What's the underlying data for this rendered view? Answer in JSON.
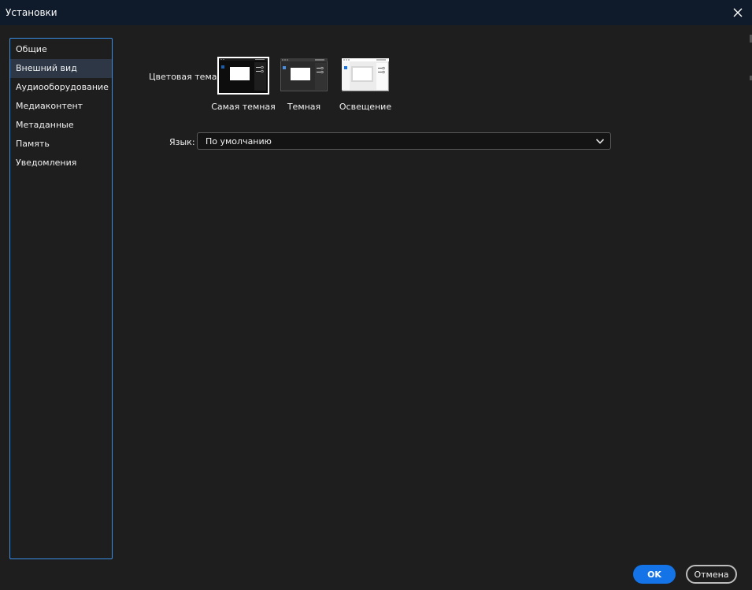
{
  "window": {
    "title": "Установки"
  },
  "sidebar": {
    "items": [
      {
        "label": "Общие",
        "active": false
      },
      {
        "label": "Внешний вид",
        "active": true
      },
      {
        "label": "Аудиооборудование",
        "active": false
      },
      {
        "label": "Медиаконтент",
        "active": false
      },
      {
        "label": "Метаданные",
        "active": false
      },
      {
        "label": "Память",
        "active": false
      },
      {
        "label": "Уведомления",
        "active": false
      }
    ]
  },
  "appearance": {
    "theme_label": "Цветовая тема",
    "themes": [
      {
        "label": "Самая темная",
        "selected": true
      },
      {
        "label": "Темная",
        "selected": false
      },
      {
        "label": "Освещение",
        "selected": false
      }
    ],
    "language_label": "Язык:",
    "language_value": "По умолчанию"
  },
  "footer": {
    "ok_label": "OK",
    "cancel_label": "Отмена"
  },
  "colors": {
    "titlebar": "#0f1a2b",
    "background": "#1e1e1e",
    "accent": "#1473e6",
    "sidebar_border": "#3a8ee6",
    "sidebar_active": "#2d3746"
  },
  "icons": {
    "close": "close-icon",
    "dropdown": "chevron-down-icon"
  }
}
